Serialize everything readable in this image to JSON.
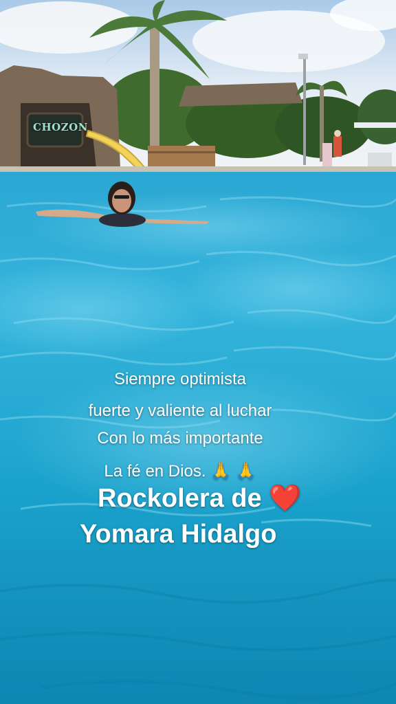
{
  "video_caption": {
    "lines": [
      "Siempre optimista",
      "fuerte y valiente al luchar",
      "Con lo más importante",
      "La fé en Dios.  🙏  🙏"
    ],
    "song_title": "Rockolera de",
    "heart": "❤️",
    "artist": "Yomara Hidalgo"
  },
  "scene": {
    "sign_text": "CHOZON",
    "icons": [
      "palm-tree",
      "water-slide",
      "heart-emoji",
      "praying-hands-emoji"
    ],
    "colors": {
      "sky": "#cfe3f4",
      "pool_light": "#36b6dd",
      "pool_deep": "#0c8cb8",
      "slide": "#f4d55c",
      "heart": "#e11d2a"
    }
  }
}
